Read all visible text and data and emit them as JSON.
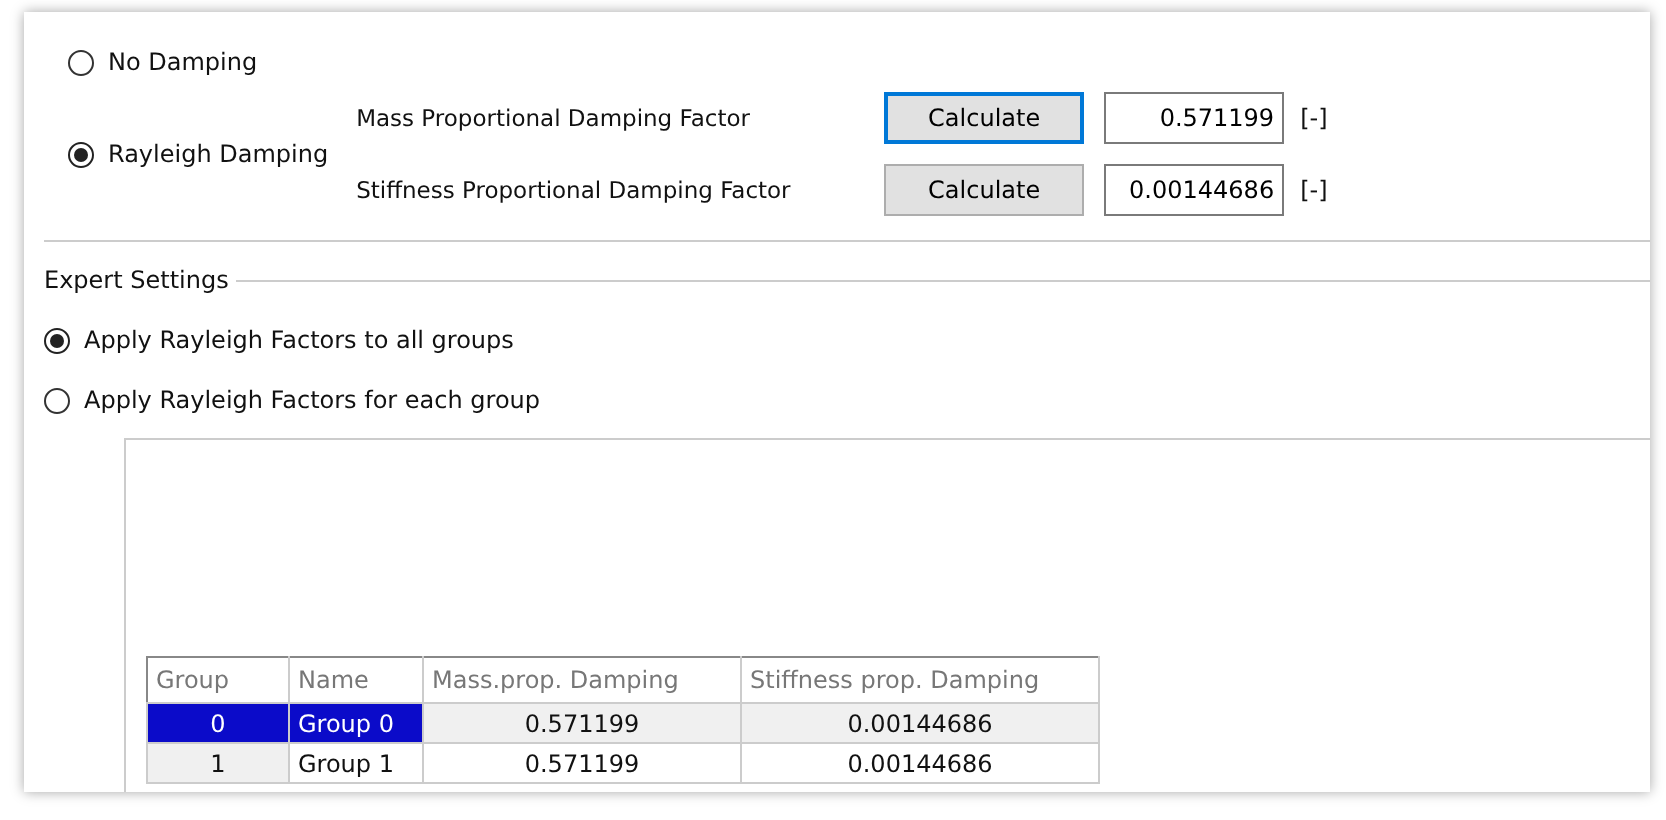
{
  "damping_options": [
    {
      "label": "No Damping",
      "selected": false
    },
    {
      "label": "Rayleigh Damping",
      "selected": true
    }
  ],
  "factors": [
    {
      "label": "Mass Proportional Damping Factor",
      "button": "Calculate",
      "focused": true,
      "value": "0.571199",
      "unit": "[-]"
    },
    {
      "label": "Stiffness Proportional Damping Factor",
      "button": "Calculate",
      "focused": false,
      "value": "0.00144686",
      "unit": "[-]"
    }
  ],
  "expert_settings": {
    "title": "Expert Settings",
    "options": [
      {
        "label": "Apply Rayleigh Factors to all groups",
        "selected": true
      },
      {
        "label": "Apply Rayleigh Factors for each group",
        "selected": false
      }
    ]
  },
  "table": {
    "columns": [
      "Group",
      "Name",
      "Mass.prop. Damping",
      "Stiffness prop. Damping"
    ],
    "rows": [
      {
        "cells": [
          "0",
          "Group 0",
          "0.571199",
          "0.00144686"
        ],
        "selected": true
      },
      {
        "cells": [
          "1",
          "Group 1",
          "0.571199",
          "0.00144686"
        ],
        "selected": false
      }
    ]
  }
}
